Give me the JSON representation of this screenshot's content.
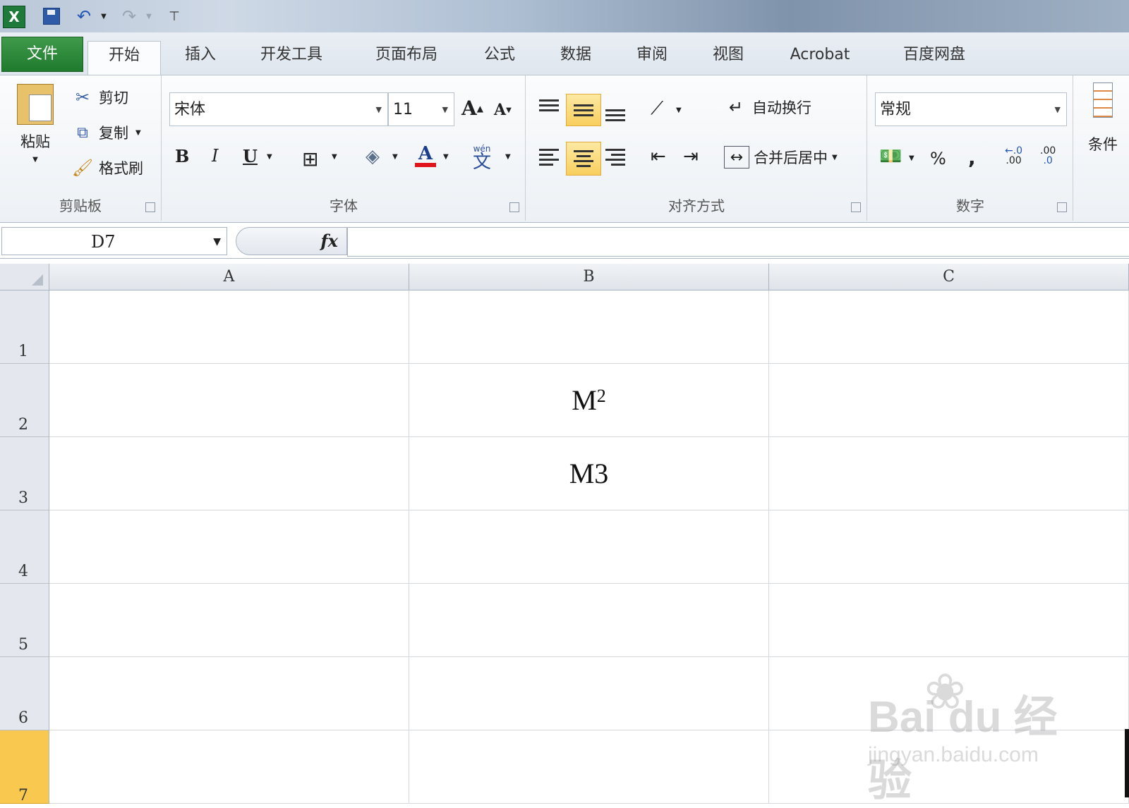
{
  "qat": {
    "app_icon": "excel-icon",
    "buttons": [
      "save-icon",
      "undo-icon",
      "redo-icon",
      "customize-icon"
    ]
  },
  "tabs": [
    {
      "label": "文件",
      "active": false
    },
    {
      "label": "开始",
      "active": true
    },
    {
      "label": "插入",
      "active": false
    },
    {
      "label": "开发工具",
      "active": false
    },
    {
      "label": "页面布局",
      "active": false
    },
    {
      "label": "公式",
      "active": false
    },
    {
      "label": "数据",
      "active": false
    },
    {
      "label": "审阅",
      "active": false
    },
    {
      "label": "视图",
      "active": false
    },
    {
      "label": "Acrobat",
      "active": false
    },
    {
      "label": "百度网盘",
      "active": false
    }
  ],
  "ribbon": {
    "clipboard": {
      "title": "剪贴板",
      "paste": "粘贴",
      "cut": "剪切",
      "copy": "复制",
      "format_painter": "格式刷"
    },
    "font": {
      "title": "字体",
      "font_name": "宋体",
      "font_size": "11",
      "bold": "B",
      "italic": "I",
      "underline": "U",
      "font_color_glyph": "A",
      "phonetic_glyph": "wén",
      "phonetic_char": "文"
    },
    "alignment": {
      "title": "对齐方式",
      "wrap_text": "自动换行",
      "merge_center": "合并后居中"
    },
    "number": {
      "title": "数字",
      "format": "常规",
      "percent": "%",
      "comma": ",",
      "increase_decimal": ".00",
      "decrease_decimal": ".0"
    },
    "styles": {
      "partial_label": "条件"
    }
  },
  "formula_bar": {
    "name_box": "D7",
    "fx_label": "fx",
    "value": ""
  },
  "sheet": {
    "columns": [
      "A",
      "B",
      "C"
    ],
    "rows": [
      "1",
      "2",
      "3",
      "4",
      "5",
      "6",
      "7"
    ],
    "selected_row": "7",
    "cells": {
      "B2": {
        "base": "M",
        "superscript": "2"
      },
      "B3": {
        "text": "M3"
      }
    }
  },
  "watermark": {
    "brand": "Bai du 经验",
    "url": "jingyan.baidu.com"
  },
  "colors": {
    "file_tab": "#2a8a38",
    "highlight": "#f8cf5e",
    "selected_row": "#f9c94f"
  }
}
